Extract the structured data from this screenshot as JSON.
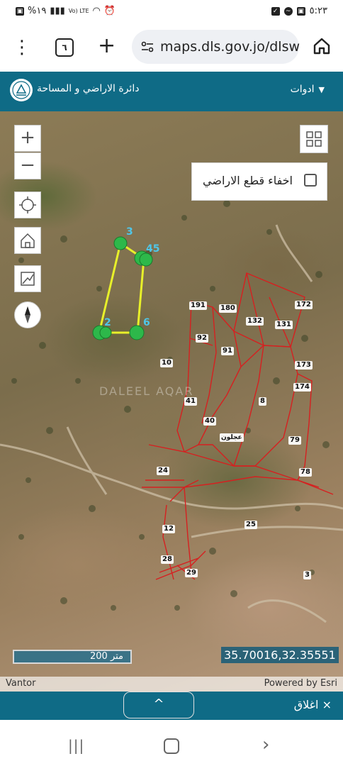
{
  "status_bar": {
    "left_text": "%١٩",
    "net_label": "Vo) LTE",
    "time": "٥:٢٣"
  },
  "browser": {
    "tab_count": "٦",
    "url": "maps.dls.gov.jo/dlsw"
  },
  "header": {
    "title": "دائرة الاراضي و المساحة",
    "tools_label": "ادوات"
  },
  "map": {
    "hide_parcels_label": "اخفاء قطع الاراضي",
    "hide_parcels_checked": false,
    "scale_label": "200 متر",
    "coordinates": "35.70016,32.35551",
    "attribution_left": "Vantor",
    "attribution_right": "Powered by Esri",
    "place_name": "عجلون",
    "watermark": "DALEEL AQAR",
    "parcel_numbers": {
      "p191": "191",
      "p180": "180",
      "p132": "132",
      "p172": "172",
      "p131": "131",
      "p92": "92",
      "p91": "91",
      "p10": "10",
      "p173": "173",
      "p174": "174",
      "p41": "41",
      "p8": "8",
      "p40": "40",
      "p79": "79",
      "p24": "24",
      "p78": "78",
      "p12": "12",
      "p25": "25",
      "p28": "28",
      "p29": "29",
      "p3": "3"
    },
    "vertex_labels": {
      "v3": "3",
      "v45": "45",
      "v2": "2",
      "v6": "6"
    }
  },
  "bottom": {
    "close_label": "اغلاق",
    "close_icon": "×",
    "expand_icon": "^"
  },
  "colors": {
    "header": "#0f6b86",
    "parcel_lines": "#d62020",
    "polygon": "#e8f02a",
    "vertex": "#2db84a"
  }
}
